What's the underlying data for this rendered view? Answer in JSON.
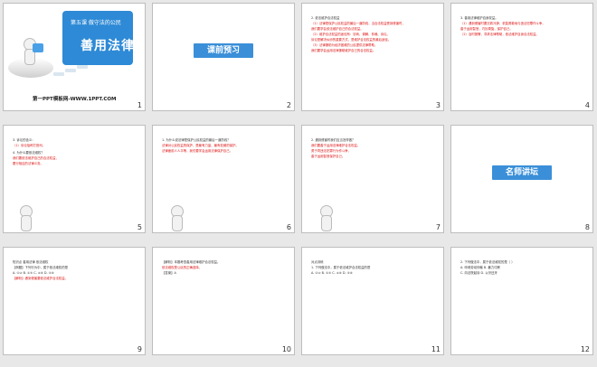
{
  "theme": {
    "accent": "#2e8ad6",
    "highlight": "#d11111",
    "text": "#222222"
  },
  "slides": [
    {
      "number": "1",
      "lesson_label": "第五课 做守法的公民",
      "title": "善用法律",
      "site": "第一PPT模板网-WWW.1PPT.COM"
    },
    {
      "number": "2",
      "button": "课前预习"
    },
    {
      "number": "3",
      "lines": [
        {
          "text": "2. 依法维护合法权益",
          "style": "gray"
        },
        {
          "text": "（1）法律是保护公民权益的最后一道防线，当合法权益受到侵害时，",
          "style": "red"
        },
        {
          "text": "我们要学会依法维护自己的合法权益。",
          "style": "red"
        },
        {
          "text": "（2）维护合法权益的途径有：协商、调解、仲裁、诉讼。",
          "style": "red"
        },
        {
          "text": "诉讼是解决纠纷的重要方式，是维护合法权益的最后途径。",
          "style": "red"
        },
        {
          "text": "（3）法律援助为经济困难的公民提供法律帮助。",
          "style": "red"
        },
        {
          "text": "我们要学会运用法律援助维护自己的合法权益。",
          "style": "red"
        }
      ]
    },
    {
      "number": "4",
      "lines": [
        {
          "text": "3. 善用法律维护自身权益。",
          "style": "gray"
        },
        {
          "text": "（1）遇到侵害时要沉着冷静，机智勇敢地与违法犯罪作斗争，",
          "style": "red"
        },
        {
          "text": "善于运用智慧，巧妙周旋，保护自己。",
          "style": "red"
        },
        {
          "text": "（2）及时报警，寻求法律帮助，依法维护自身合法权益。",
          "style": "red"
        }
      ]
    },
    {
      "number": "5",
      "lines": [
        {
          "text": "3. 诉讼的含义：",
          "style": "gray"
        },
        {
          "text": "（1）诉讼俗称打官司。",
          "style": "red"
        },
        {
          "text": "4. 为什么要依法维权？",
          "style": "gray"
        },
        {
          "text": "我们要依法维护自己的合法权益，",
          "style": "red"
        },
        {
          "text": "履行相应的法律义务。",
          "style": "red"
        }
      ]
    },
    {
      "number": "6",
      "lines": [
        {
          "text": "1. 为什么说法律是保护公民权益的最后一道防线？",
          "style": "gray"
        },
        {
          "text": "法律对公民权益的保护，是最有力量、最有权威的保护。",
          "style": "red"
        },
        {
          "text": "法律面前人人平等，我们要学会运用法律保护自己。",
          "style": "red"
        }
      ]
    },
    {
      "number": "7",
      "lines": [
        {
          "text": "2. 遇到侵害时我们应当怎样做？",
          "style": "gray"
        },
        {
          "text": "我们要善于运用法律维护合法权益，",
          "style": "red"
        },
        {
          "text": "勇于同违法犯罪行为作斗争，",
          "style": "red"
        },
        {
          "text": "善于运用智慧保护自己。",
          "style": "red"
        }
      ]
    },
    {
      "number": "8",
      "button": "名师讲坛"
    },
    {
      "number": "9",
      "lines": [
        {
          "text": "知识点 善用法律 依法维权",
          "style": "gray"
        },
        {
          "text": "【例题】下列行为中，属于依法维权的是",
          "style": "gray"
        },
        {
          "text": "A. ①② B. ①③ C. ②④ D. ③④",
          "style": "gray"
        },
        {
          "text": "【解析】遇到侵害要依法维护合法权益。",
          "style": "red"
        }
      ]
    },
    {
      "number": "10",
      "lines": [
        {
          "text": "【解析】本题考查善用法律维护合法权益。",
          "style": "gray"
        },
        {
          "text": "依法维权是公民的正确选择。",
          "style": "red"
        },
        {
          "text": "【答案】A",
          "style": "gray"
        }
      ]
    },
    {
      "number": "11",
      "lines": [
        {
          "text": "对点训练",
          "style": "gray"
        },
        {
          "text": "1. 下列做法中，属于依法维护合法权益的是",
          "style": "gray"
        },
        {
          "text": "A. ①② B. ①③ C. ②④ D. ③④",
          "style": "gray"
        }
      ]
    },
    {
      "number": "12",
      "lines": [
        {
          "text": "2. 下列做法中，属于依法维权的是（ ）",
          "style": "gray"
        },
        {
          "text": "A. 申请劳动仲裁 B. 暴力讨薪",
          "style": "gray"
        },
        {
          "text": "C. 向法院起诉 D. 以牙还牙",
          "style": "gray"
        }
      ]
    }
  ]
}
